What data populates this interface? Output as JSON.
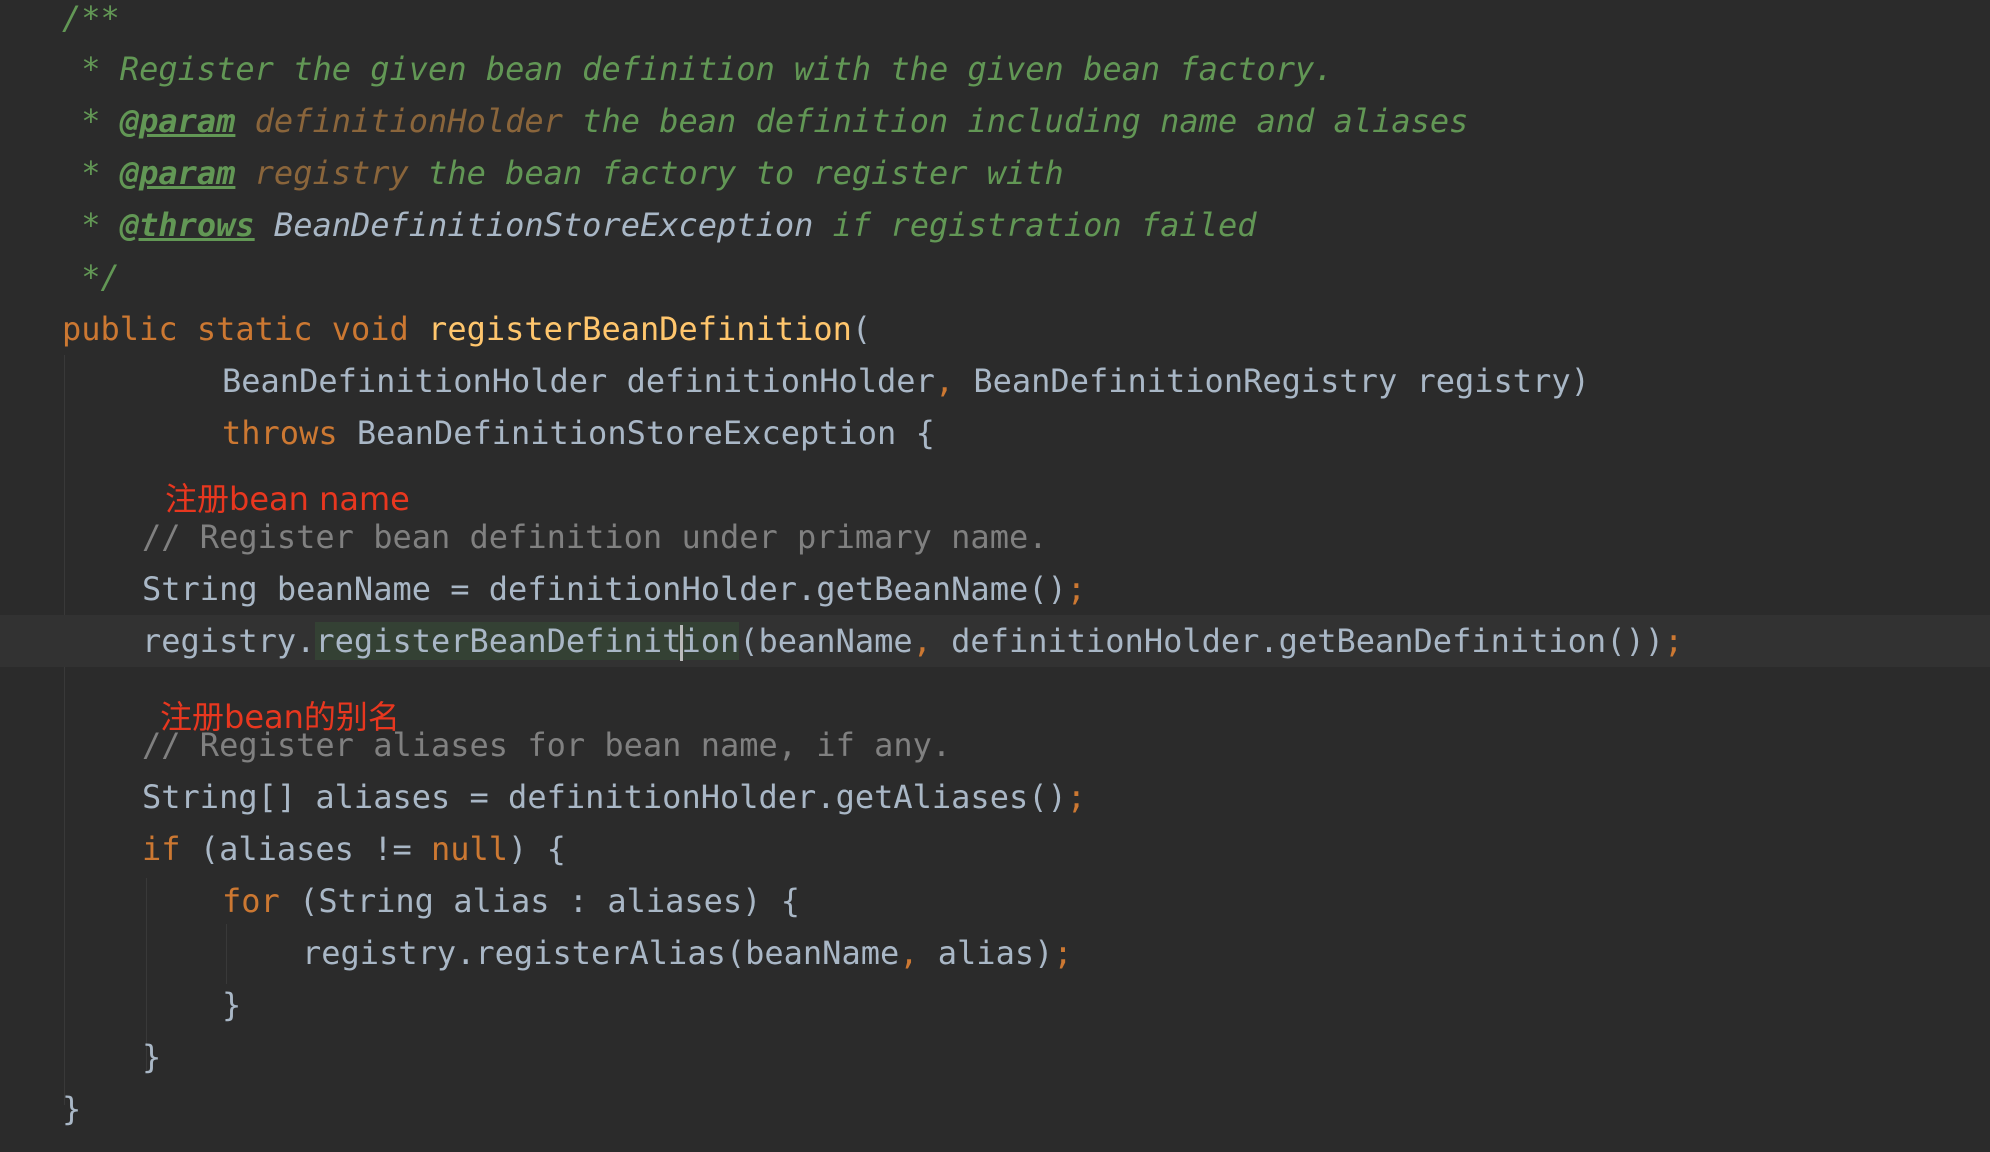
{
  "editor": {
    "doc": {
      "open": "/**",
      "line1": " * Register the given bean definition with the given bean factory.",
      "line2_prefix": " * ",
      "line2_tag": "@param",
      "line2_param": " definitionHolder",
      "line2_text": " the bean definition including name and aliases",
      "line3_prefix": " * ",
      "line3_tag": "@param",
      "line3_param": " registry",
      "line3_text": " the bean factory to register with",
      "line4_prefix": " * ",
      "line4_tag": "@throws",
      "line4_ref": " BeanDefinitionStoreException",
      "line4_text": " if registration failed",
      "close": " */"
    },
    "signature": {
      "public": "public",
      "static": "static",
      "void": "void",
      "name": "registerBeanDefinition",
      "open_paren": "(",
      "param1_type": "BeanDefinitionHolder",
      "param1_name": "definitionHolder",
      "comma": ",",
      "param2_type": "BeanDefinitionRegistry",
      "param2_name": "registry)",
      "throws": "throws",
      "exception": "BeanDefinitionStoreException {"
    },
    "body": {
      "comment1": "// Register bean definition under primary name.",
      "line_beanname": "String beanName = definitionHolder.getBeanName()",
      "semicolon": ";",
      "reg_obj": "registry.",
      "reg_hl_a": "registerBeanDefinit",
      "reg_hl_b": "ion",
      "reg_args_a": "(beanName",
      "reg_args_b": " definitionHolder.getBeanDefinition())",
      "comment2": "// Register aliases for bean name, if any.",
      "line_aliases": "String[] aliases = definitionHolder.getAliases()",
      "if_kw": "if",
      "if_cond_a": " (aliases != ",
      "null_kw": "null",
      "if_cond_b": ") {",
      "for_kw": "for",
      "for_rest": " (String alias : aliases) {",
      "alias_call_a": "registry.registerAlias(beanName",
      "alias_call_b": " alias)",
      "brace": "}"
    },
    "annotations": {
      "note1": "注册bean name",
      "note2": "注册bean的别名"
    },
    "colors": {
      "background": "#2b2b2b",
      "keyword": "#cc7832",
      "method": "#ffc66d",
      "doc_comment": "#629755",
      "line_comment": "#808080",
      "annotation": "#e8371f"
    }
  }
}
